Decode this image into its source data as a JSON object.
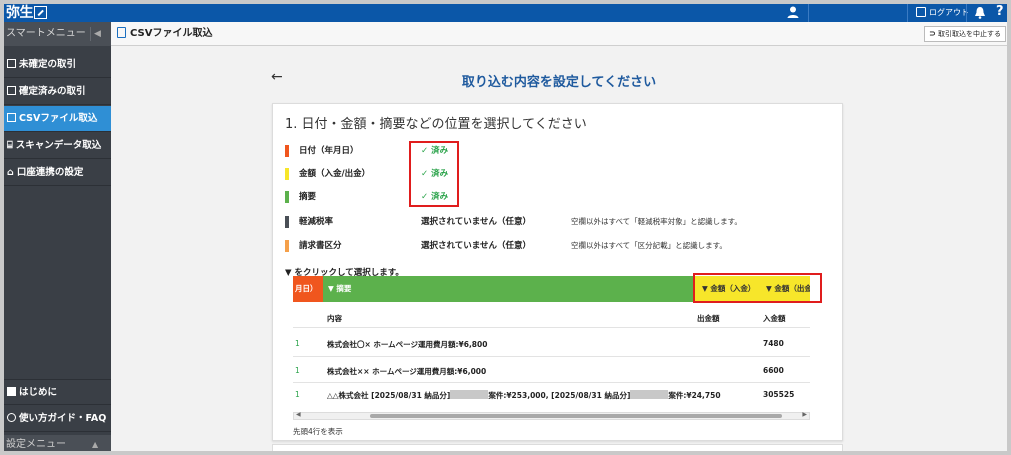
{
  "header": {
    "logo": "弥生",
    "logout_label": "ログアウト",
    "help_label": "?"
  },
  "subbar": {
    "smart_menu": "スマートメニュー",
    "smart_toggle": "◀",
    "tab_title": "CSVファイル取込",
    "stop_button": "取引取込を中止する"
  },
  "sidebar": {
    "items": [
      {
        "label": "未確定の取引"
      },
      {
        "label": "確定済みの取引"
      },
      {
        "label": "CSVファイル取込"
      },
      {
        "label": "スキャンデータ取込"
      },
      {
        "label": "口座連携の設定"
      }
    ],
    "bottom_items": [
      {
        "label": "はじめに"
      },
      {
        "label": "使い方ガイド・FAQ"
      }
    ],
    "settings_menu": "設定メニュー",
    "settings_arrow": "▲"
  },
  "main": {
    "back_arrow": "←",
    "title": "取り込む内容を設定してください",
    "step_title": "1. 日付・金額・摘要などの位置を選択してください",
    "fields": [
      {
        "label": "日付（年月日）",
        "status": "✓ 済み",
        "note": "",
        "color": "#f0561e"
      },
      {
        "label": "金額（入金/出金）",
        "status": "✓ 済み",
        "note": "",
        "color": "#f7e62a"
      },
      {
        "label": "摘要",
        "status": "✓ 済み",
        "note": "",
        "color": "#5cb14c"
      },
      {
        "label": "軽減税率",
        "status": "選択されていません（任意）",
        "note": "空欄以外はすべて「軽減税率対象」と認識します。",
        "color": "#4a4f56"
      },
      {
        "label": "請求書区分",
        "status": "選択されていません（任意）",
        "note": "空欄以外はすべて「区分記載」と認識します。",
        "color": "#f5a04a"
      }
    ],
    "hint": "▼ をクリックして選択します。",
    "table": {
      "header_orange": "月日）",
      "header_green": "▼ 摘要",
      "header_yellow_1": "▼ 金額（入金）",
      "header_yellow_2": "▼ 金額（出金）",
      "col_content": "内容",
      "col_out": "出金額",
      "col_in": "入金額",
      "rows": [
        {
          "num": "1",
          "content": "株式会社〇× ホームページ運用費月額:¥6,800",
          "out": "",
          "in": "7480"
        },
        {
          "num": "1",
          "content": "株式会社×× ホームページ運用費月額:¥6,000",
          "out": "",
          "in": "6600"
        },
        {
          "num": "1",
          "content_a": "△△株式会社 [2025/08/31 納品分]",
          "content_b": "案件:¥253,000, [2025/08/31 納品分]",
          "content_c": "案件:¥24,750",
          "out": "",
          "in": "305525"
        }
      ]
    },
    "scroll_left": "◀",
    "scroll_right": "▶",
    "foot_note": "先頭4行を表示"
  }
}
